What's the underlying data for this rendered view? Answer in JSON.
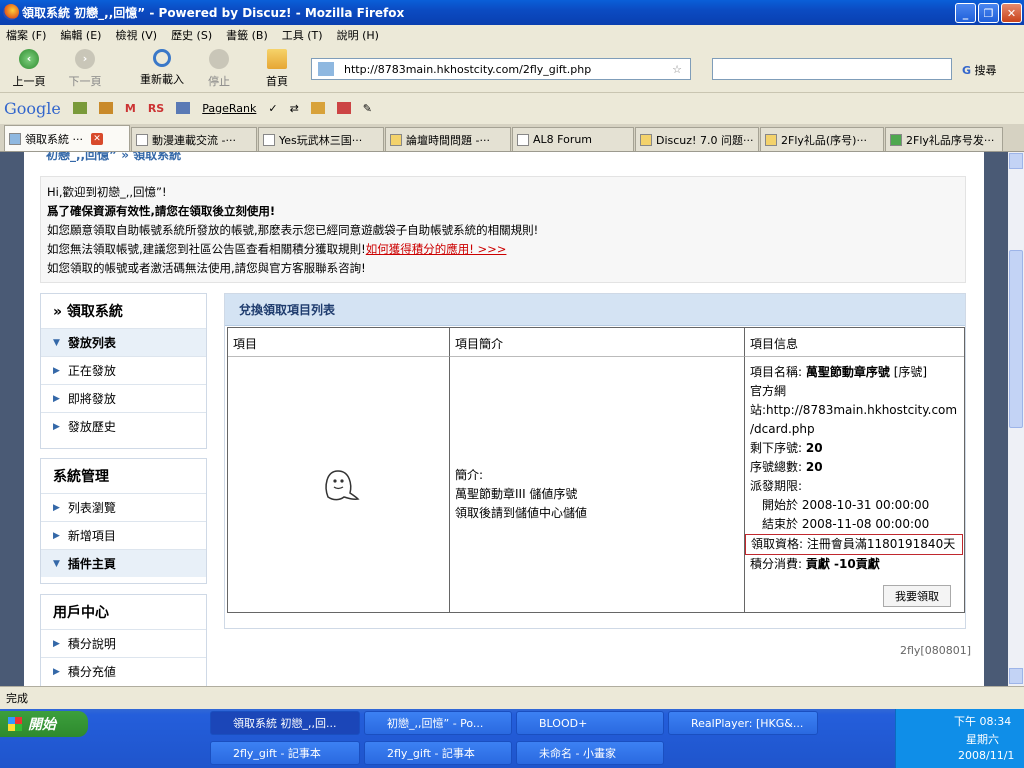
{
  "window": {
    "title": "領取系統 初戀_,,回憶” - Powered by Discuz! - Mozilla Firefox"
  },
  "menu": [
    "檔案 (F)",
    "編輯 (E)",
    "檢視 (V)",
    "歷史 (S)",
    "書籤 (B)",
    "工具 (T)",
    "說明 (H)"
  ],
  "nav": {
    "back": "上一頁",
    "forward": "下一頁",
    "reload": "重新載入",
    "stop": "停止",
    "home": "首頁",
    "url": "http://8783main.hkhostcity.com/2fly_gift.php",
    "search_btn": "搜尋"
  },
  "googlebar": {
    "logo": "Google",
    "pagerank": "PageRank",
    "rs": "RS"
  },
  "tabs": [
    {
      "label": "領取系統 ···",
      "active": true
    },
    {
      "label": "動漫連載交流 -···"
    },
    {
      "label": "Yes玩武林三国···"
    },
    {
      "label": "論壇時間問題 -···"
    },
    {
      "label": "AL8 Forum"
    },
    {
      "label": "Discuz! 7.0 问题···"
    },
    {
      "label": "2Fly礼品(序号)···"
    },
    {
      "label": "2Fly礼品序号发···"
    }
  ],
  "page": {
    "breadcrumb_site": "初戀_,,回憶”",
    "breadcrumb_sep": " » ",
    "breadcrumb_current": "領取系統",
    "notice": {
      "line1": "Hi,歡迎到初戀_,,回憶”!",
      "line2": "爲了確保資源有效性,請您在領取後立刻使用!",
      "line3": "如您願意領取自助帳號系統所發放的帳號,那麽表示您已經同意遊戲袋子自助帳號系統的相關規則!",
      "line4": "如您無法領取帳號,建議您到社區公告區查看相關積分獲取規則!",
      "line4_link": "如何獲得積分的應用! >>>",
      "line5": "如您領取的帳號或者激活碼無法使用,請您與官方客服聯系咨詢!"
    },
    "sidebar": {
      "section1_title": "» 領取系統",
      "section1_sub": "發放列表",
      "section1_items": [
        "正在發放",
        "即將發放",
        "發放歷史"
      ],
      "section2_title": "系統管理",
      "section2_items": [
        "列表瀏覽",
        "新增項目"
      ],
      "section2_sub": "插件主頁",
      "section3_title": "用戶中心",
      "section3_items": [
        "積分說明",
        "積分充値"
      ]
    },
    "table": {
      "title": "兌換領取項目列表",
      "col_item": "項目",
      "col_intro": "項目簡介",
      "col_info": "項目信息",
      "intro_label": "簡介:",
      "intro_line1": "萬聖節動章III 儲値序號",
      "intro_line2": "領取後請到儲値中心儲値",
      "info_name_label": "項目名稱: ",
      "info_name": "萬聖節動章序號",
      "info_name_tag": " [序號]",
      "info_site_a": "官方網",
      "info_site_b": "站:http://8783main.hkhostcity.com",
      "info_site_c": "/dcard.php",
      "info_remain_label": "剩下序號: ",
      "info_remain": "20",
      "info_total_label": "序號總數: ",
      "info_total": "20",
      "info_period": "派發期限:",
      "info_start": "開始於 2008-10-31 00:00:00",
      "info_end": "結束於 2008-11-08 00:00:00",
      "info_qual": "領取資格: 注冊會員滿1180191840天",
      "info_cost_label": "積分消費: ",
      "info_cost": "貢獻 -10貢獻",
      "claim_button": "我要領取"
    },
    "footer_version": "2fly[080801]"
  },
  "status": "完成",
  "taskbar": {
    "start": "開始",
    "row1": [
      "領取系統 初戀_,,回...",
      "初戀_,,回憶” - Po...",
      "BLOOD+",
      "RealPlayer: [HKG&..."
    ],
    "row2": [
      "2fly_gift - 記事本",
      "2fly_gift - 記事本",
      "未命名 - 小畫家"
    ],
    "clock_time": "下午 08:34",
    "clock_day": "星期六",
    "clock_date": "2008/11/1"
  }
}
